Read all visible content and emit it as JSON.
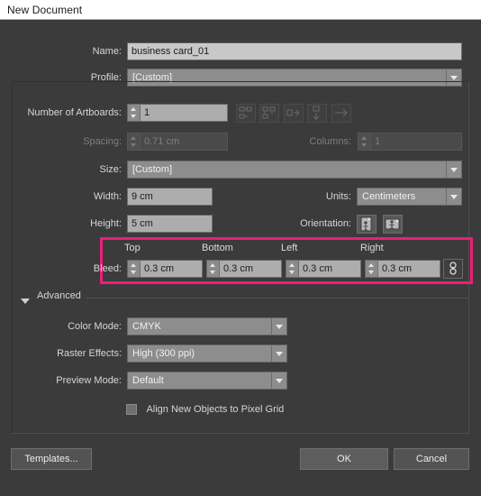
{
  "window": {
    "title": "New Document"
  },
  "form": {
    "name": {
      "label": "Name:",
      "value": "business card_01"
    },
    "profile": {
      "label": "Profile:",
      "value": "[Custom]"
    },
    "number_of_artboards": {
      "label": "Number of Artboards:",
      "value": "1"
    },
    "artboard_layout_buttons": [
      {
        "name": "grid-by-row-icon",
        "enabled": false
      },
      {
        "name": "grid-by-column-icon",
        "enabled": false
      },
      {
        "name": "arrange-by-row-icon",
        "enabled": false
      },
      {
        "name": "arrange-by-column-icon",
        "enabled": false
      },
      {
        "name": "layout-direction-icon",
        "enabled": false
      }
    ],
    "spacing": {
      "label": "Spacing:",
      "value": "0.71 cm",
      "enabled": false
    },
    "columns": {
      "label": "Columns:",
      "value": "1",
      "enabled": false
    },
    "size": {
      "label": "Size:",
      "value": "[Custom]"
    },
    "width": {
      "label": "Width:",
      "value": "9 cm"
    },
    "units": {
      "label": "Units:",
      "value": "Centimeters"
    },
    "height": {
      "label": "Height:",
      "value": "5 cm"
    },
    "orientation": {
      "label": "Orientation:",
      "portrait": "portrait-icon",
      "landscape": "landscape-icon"
    },
    "bleed": {
      "label": "Bleed:",
      "highlight_color": "#ec1e79",
      "top": {
        "label": "Top",
        "value": "0.3 cm"
      },
      "bottom": {
        "label": "Bottom",
        "value": "0.3 cm"
      },
      "left": {
        "label": "Left",
        "value": "0.3 cm"
      },
      "right": {
        "label": "Right",
        "value": "0.3 cm"
      },
      "link_icon": "link-chain-icon"
    },
    "advanced": {
      "label": "Advanced",
      "color_mode": {
        "label": "Color Mode:",
        "value": "CMYK"
      },
      "raster_effects": {
        "label": "Raster Effects:",
        "value": "High (300 ppi)"
      },
      "preview_mode": {
        "label": "Preview Mode:",
        "value": "Default"
      },
      "align_pixel_grid": {
        "label": "Align New Objects to Pixel Grid",
        "checked": false
      }
    }
  },
  "footer": {
    "templates": "Templates...",
    "ok": "OK",
    "cancel": "Cancel"
  }
}
